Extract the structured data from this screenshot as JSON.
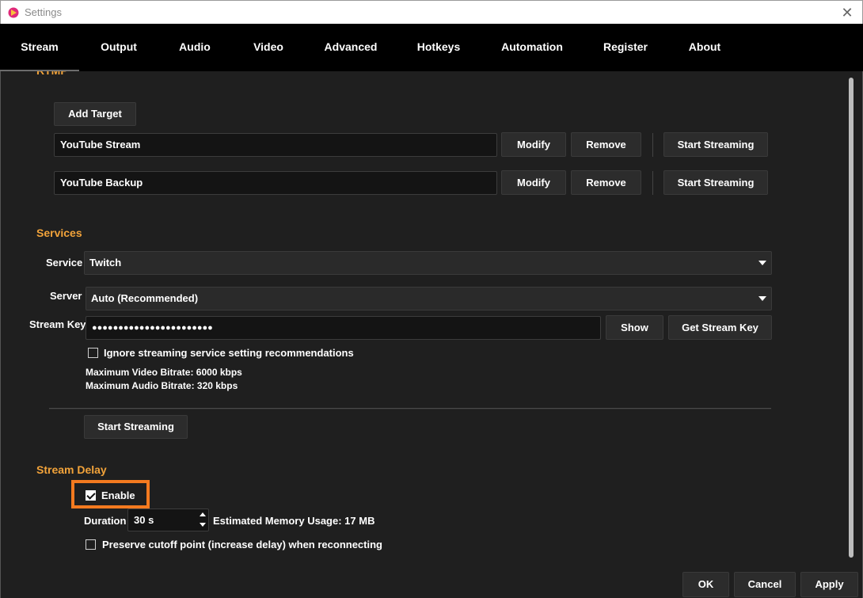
{
  "window": {
    "title": "Settings"
  },
  "tabs": [
    "Stream",
    "Output",
    "Audio",
    "Video",
    "Advanced",
    "Hotkeys",
    "Automation",
    "Register",
    "About"
  ],
  "rtmp": {
    "add_target_label": "Add Target",
    "targets": [
      {
        "name": "YouTube Stream",
        "modify": "Modify",
        "remove": "Remove",
        "start": "Start Streaming"
      },
      {
        "name": "YouTube Backup",
        "modify": "Modify",
        "remove": "Remove",
        "start": "Start Streaming"
      }
    ]
  },
  "services": {
    "heading": "Services",
    "service_label": "Service",
    "service_value": "Twitch",
    "server_label": "Server",
    "server_value": "Auto (Recommended)",
    "stream_key_label": "Stream Key",
    "stream_key_value": "●●●●●●●●●●●●●●●●●●●●●●●",
    "show_label": "Show",
    "get_key_label": "Get Stream Key",
    "ignore_label": "Ignore streaming service setting recommendations",
    "max_video": "Maximum Video Bitrate: 6000 kbps",
    "max_audio": "Maximum Audio Bitrate: 320 kbps",
    "start_label": "Start Streaming"
  },
  "delay": {
    "heading": "Stream Delay",
    "enable_label": "Enable",
    "enabled": true,
    "duration_label": "Duration",
    "duration_value": "30 s",
    "memory_usage": "Estimated Memory Usage: 17 MB",
    "preserve_label": "Preserve cutoff point (increase delay) when reconnecting"
  },
  "footer": {
    "ok": "OK",
    "cancel": "Cancel",
    "apply": "Apply"
  },
  "colors": {
    "accent_orange": "#f2a33a",
    "highlight": "#f47a1f",
    "background": "#1f1f1f",
    "tabbar": "#000000"
  }
}
